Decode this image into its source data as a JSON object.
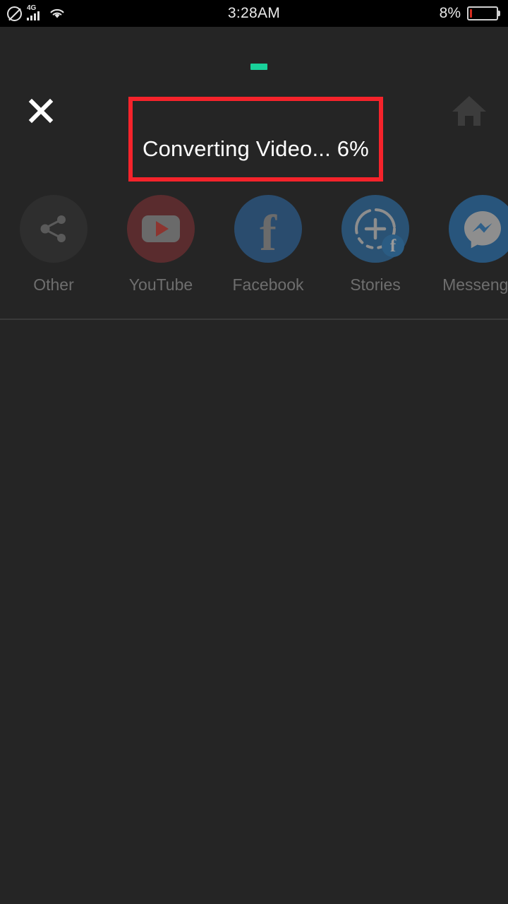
{
  "status_bar": {
    "icons": {
      "no_sim": "no-sim-icon",
      "network_type": "4G",
      "signal": "signal-bars-icon",
      "wifi": "wifi-icon"
    },
    "clock": "3:28AM",
    "battery_percent_label": "8%",
    "battery_level": 8,
    "battery_color": "#d42b1f"
  },
  "top_progress": {
    "percent": 6,
    "color": "#19d19a"
  },
  "header": {
    "close_icon": "close-icon",
    "home_icon": "home-icon"
  },
  "progress_status": {
    "text": "Converting Video... 6%",
    "percent": 6,
    "highlight_color": "#f5232b"
  },
  "share_targets": [
    {
      "id": "other",
      "label": "Other",
      "icon": "share-icon",
      "circle_color": "#2e2e2e"
    },
    {
      "id": "youtube",
      "label": "YouTube",
      "icon": "youtube-icon",
      "circle_color": "#5a2c2e"
    },
    {
      "id": "facebook",
      "label": "Facebook",
      "icon": "facebook-icon",
      "circle_color": "#2a4c6e"
    },
    {
      "id": "stories",
      "label": "Stories",
      "icon": "facebook-stories-icon",
      "circle_color": "#2a5274"
    },
    {
      "id": "messenger",
      "label": "Messenger",
      "icon": "messenger-icon",
      "circle_color": "#28557c"
    }
  ],
  "theme": {
    "background": "#252525",
    "status_bar_background": "#000000",
    "label_color": "#6e6e6e",
    "divider_color": "#3a3a3a"
  }
}
